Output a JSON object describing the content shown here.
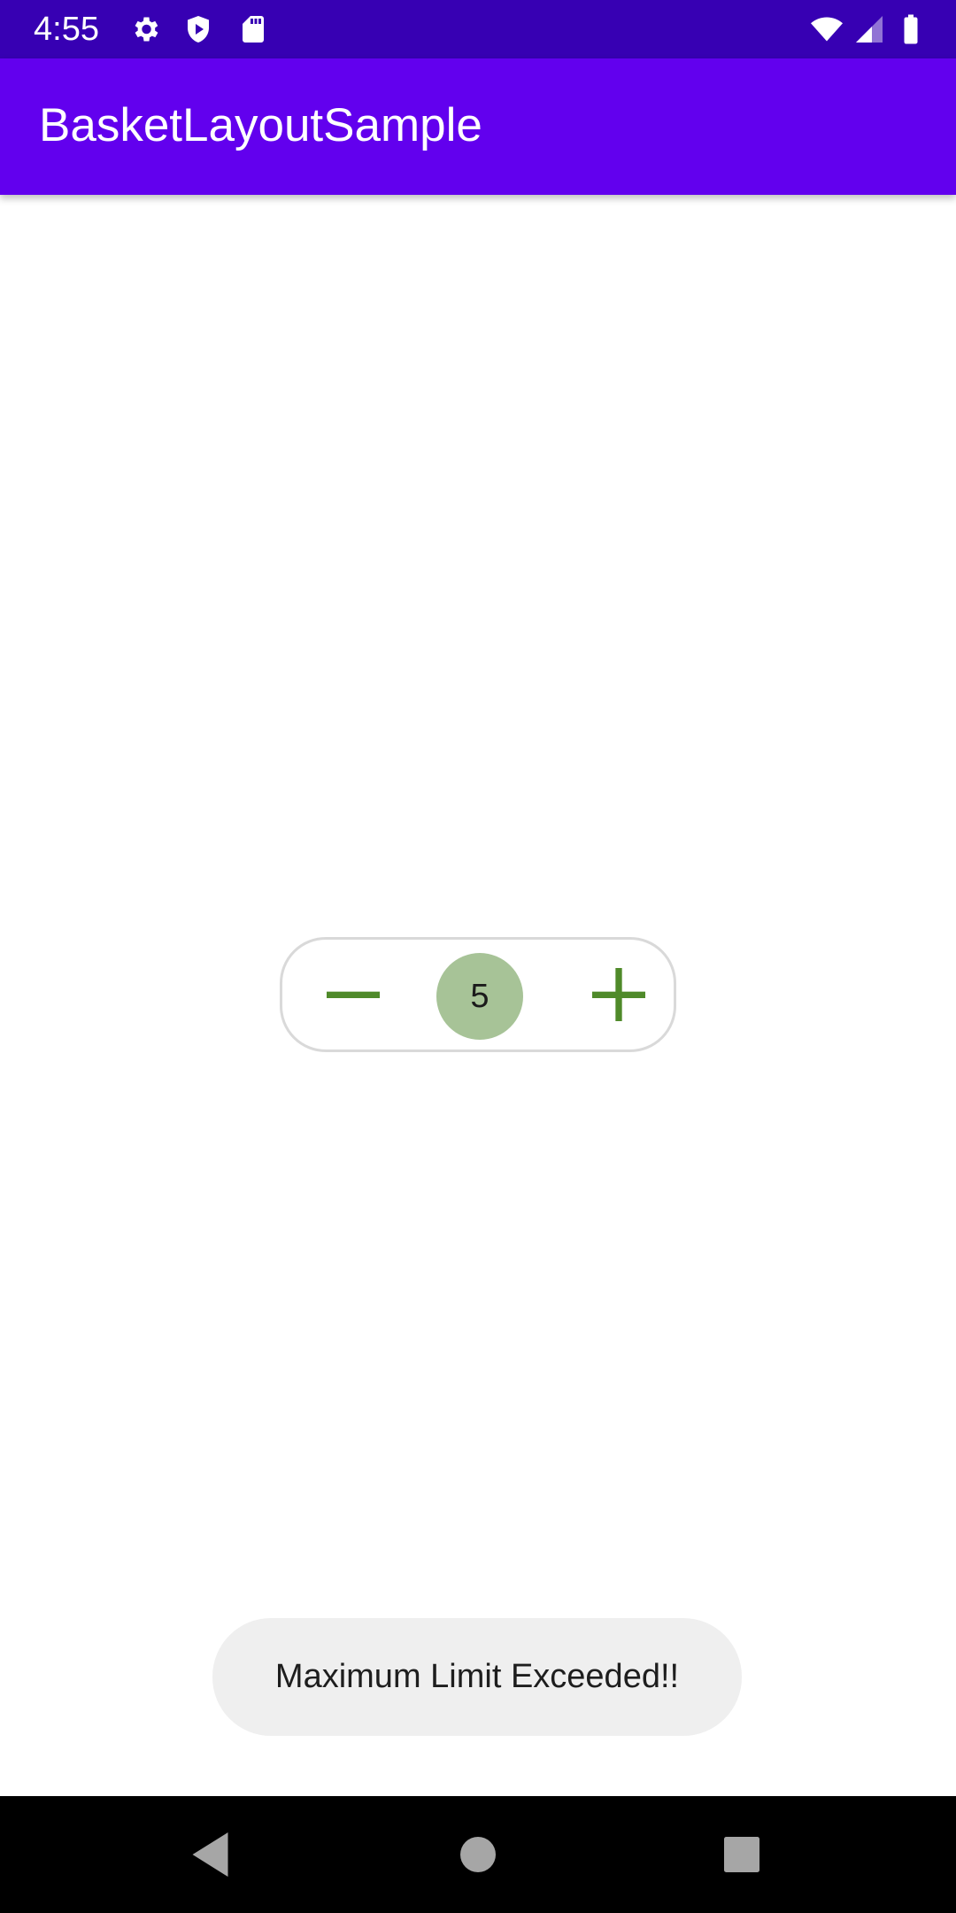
{
  "status_bar": {
    "time": "4:55",
    "icons": [
      "settings-gear-icon",
      "shield-icon",
      "sd-card-icon",
      "wifi-icon",
      "cellular-signal-icon",
      "battery-icon"
    ]
  },
  "app_bar": {
    "title": "BasketLayoutSample"
  },
  "stepper": {
    "decrement_icon": "minus-icon",
    "increment_icon": "plus-icon",
    "quantity": "5"
  },
  "toast": {
    "message": "Maximum Limit Exceeded!!"
  },
  "nav_bar": {
    "buttons": [
      "back-icon",
      "home-icon",
      "recents-icon"
    ]
  },
  "colors": {
    "status_bar": "#3700b3",
    "app_bar": "#6200ee",
    "accent_green": "#4f8a2a",
    "quantity_bg": "#a7c397",
    "toast_bg": "#efefef"
  }
}
